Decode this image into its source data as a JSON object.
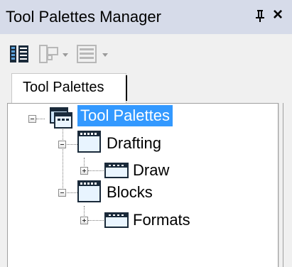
{
  "titlebar": {
    "title": "Tool Palettes Manager",
    "pin_glyph": "ᵖ",
    "close_glyph": "×"
  },
  "toolbar": {
    "buttons": [
      {
        "icon": "palette-manager-icon"
      },
      {
        "icon": "new-palette-icon",
        "has_dropdown": true
      },
      {
        "icon": "view-options-icon",
        "has_dropdown": true
      }
    ]
  },
  "tabs": [
    {
      "label": "Tool Palettes",
      "selected": true
    }
  ],
  "tree": {
    "root": {
      "label": "Tool Palettes",
      "selected": true,
      "expanded": true
    },
    "groups": [
      {
        "label": "Drafting",
        "expanded": true,
        "children": [
          {
            "label": "Draw",
            "expanded": false
          }
        ]
      },
      {
        "label": "Blocks",
        "expanded": true,
        "children": [
          {
            "label": "Formats",
            "expanded": false
          }
        ]
      }
    ]
  },
  "colors": {
    "titlebar_bg": "#d6dbe9",
    "selection_bg": "#3399ff",
    "panel_bg": "#f0f0f0"
  }
}
